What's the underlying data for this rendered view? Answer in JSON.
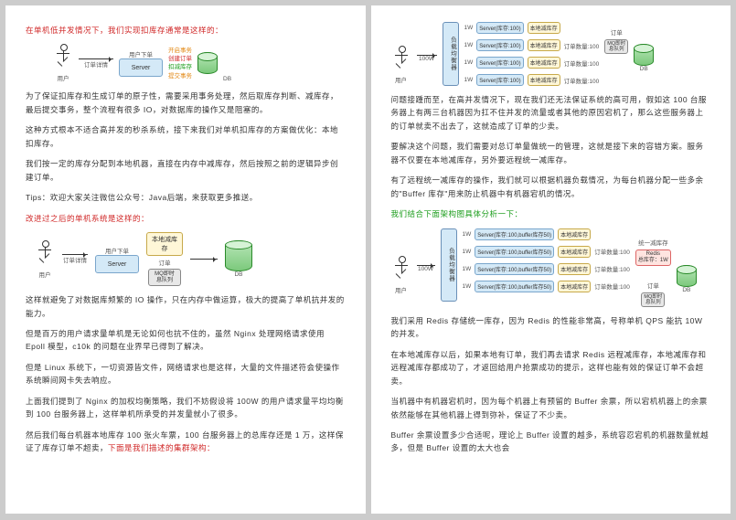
{
  "page1": {
    "p1": "在单机低并发情况下，我们实现扣库存通常是这样的：",
    "d1": {
      "userSub": "用户下单",
      "userLabel": "用户",
      "tx_open": "开启事务",
      "tx_create": "创建订单",
      "tx_dec": "扣减库存",
      "tx_commit": "提交事务",
      "server": "Server",
      "db": "DB",
      "orderDetail": "订单详情"
    },
    "p2": "为了保证扣库存和生成订单的原子性，需要采用事务处理，然后取库存判断、减库存，最后提交事务，整个流程有很多 IO，对数据库的操作又是阻塞的。",
    "p3": "这种方式根本不适合高并发的秒杀系统，接下来我们对单机扣库存的方案做优化：本地扣库存。",
    "p4": "我们按一定的库存分配到本地机器，直接在内存中减库存，然后按照之前的逻辑异步创建订单。",
    "p5": "Tips：欢迎大家关注微信公众号：Java后端，来获取更多推送。",
    "p6": "改进过之后的单机系统是这样的：",
    "d2": {
      "userSub": "用户下单",
      "userLabel": "用户",
      "server": "Server",
      "local": "本地减库存",
      "order": "订单",
      "queue1": "MQ即时",
      "queue2": "息队列",
      "db": "DB",
      "orderDetail": "订单详情"
    },
    "p7": "这样就避免了对数据库频繁的 IO 操作，只在内存中做运算，极大的提高了单机抗并发的能力。",
    "p8": "但是百万的用户请求量单机是无论如何也抗不住的，虽然 Nginx 处理网络请求使用 Epoll 模型，c10k 的问题在业界早已得到了解决。",
    "p9": "但是 Linux 系统下，一切资源皆文件，网络请求也是这样，大量的文件描述符会使操作系统瞬间网卡失去响应。",
    "p10": "上面我们提到了 Nginx 的加权均衡策略，我们不妨假设将 100W 的用户请求量平均均衡到 100 台服务器上，这样单机所承受的并发量就小了很多。",
    "p11a": "然后我们每台机器本地库存 100 张火车票，100 台服务器上的总库存还是 1 万，这样保证了库存订单不超卖，",
    "p11b": "下面是我们描述的集群架构："
  },
  "page2": {
    "d3": {
      "userLabel": "用户",
      "req": "100W",
      "lb": "负载均衡器",
      "per": "1W",
      "server": "Server(库存:100)",
      "local": "本地减库存",
      "qty": "订单数量:100",
      "order": "订单",
      "queue1": "MQ即时",
      "queue2": "息队列",
      "db": "DB"
    },
    "p1": "问题接踵而至，在高并发情况下，现在我们还无法保证系统的高可用，假如这 100 台服务器上有两三台机器因为扛不住并发的流量或者其他的原因宕机了，那么这些服务器上的订单就卖不出去了，这就造成了订单的少卖。",
    "p2": "要解决这个问题，我们需要对总订单量做统一的管理，这就是接下来的容错方案。服务器不仅要在本地减库存，另外要远程统一减库存。",
    "p3": "有了远程统一减库存的操作，我们就可以根据机器负载情况，为每台机器分配一些多余的\"Buffer 库存\"用来防止机器中有机器宕机的情况。",
    "p4": "我们结合下面架构图具体分析一下：",
    "d4": {
      "userLabel": "用户",
      "req": "100W",
      "lb": "负载均衡器",
      "per": "1W",
      "server": "Server(库存:100,buffer库存50)",
      "local": "本地减库存",
      "remote": "统一减库存",
      "redis1": "Redis",
      "redis2": "总库存：1W",
      "qty": "订单数量:100",
      "order": "订单",
      "queue1": "MQ即时",
      "queue2": "息队列",
      "db": "DB"
    },
    "p5": "我们采用 Redis 存储统一库存，因为 Redis 的性能非常高，号称单机 QPS 能抗 10W 的并发。",
    "p6": "在本地减库存以后，如果本地有订单，我们再去请求 Redis 远程减库存，本地减库存和远程减库存都成功了，才返回给用户抢票成功的提示，这样也能有效的保证订单不会超卖。",
    "p7": "当机器中有机器宕机时，因为每个机器上有预留的 Buffer 余票，所以宕机机器上的余票依然能够在其他机器上得到弥补，保证了不少卖。",
    "p8": "Buffer 余票设置多少合适呢，理论上 Buffer 设置的越多，系统容忍宕机的机器数量就越多，但是 Buffer 设置的太大也会"
  }
}
